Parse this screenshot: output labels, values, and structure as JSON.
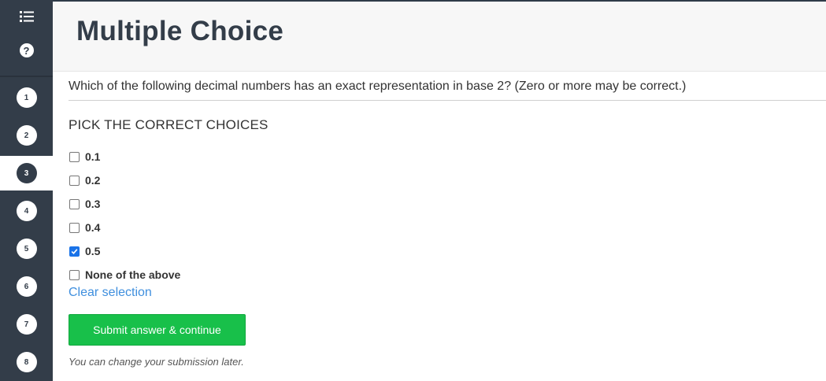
{
  "header": {
    "title": "Multiple Choice"
  },
  "sidebar": {
    "menu_icon": "list-icon",
    "help_icon": "question-circle-icon",
    "help_glyph": "?",
    "steps": [
      {
        "number": "1",
        "active": false
      },
      {
        "number": "2",
        "active": false
      },
      {
        "number": "3",
        "active": true
      },
      {
        "number": "4",
        "active": false
      },
      {
        "number": "5",
        "active": false
      },
      {
        "number": "6",
        "active": false
      },
      {
        "number": "7",
        "active": false
      },
      {
        "number": "8",
        "active": false
      }
    ]
  },
  "question": {
    "text": "Which of the following decimal numbers has an exact representation in base 2? (Zero or more may be correct.)",
    "pick_heading": "PICK THE CORRECT CHOICES",
    "choices": [
      {
        "label": "0.1",
        "checked": false
      },
      {
        "label": "0.2",
        "checked": false
      },
      {
        "label": "0.3",
        "checked": false
      },
      {
        "label": "0.4",
        "checked": false
      },
      {
        "label": "0.5",
        "checked": true
      },
      {
        "label": "None of the above",
        "checked": false
      }
    ],
    "clear_label": "Clear selection",
    "submit_label": "Submit answer & continue",
    "note": "You can change your submission later."
  },
  "colors": {
    "sidebar_bg": "#333d49",
    "accent_link": "#3f8fde",
    "submit_bg": "#18c04a",
    "checkbox_checked": "#1a73e8"
  }
}
